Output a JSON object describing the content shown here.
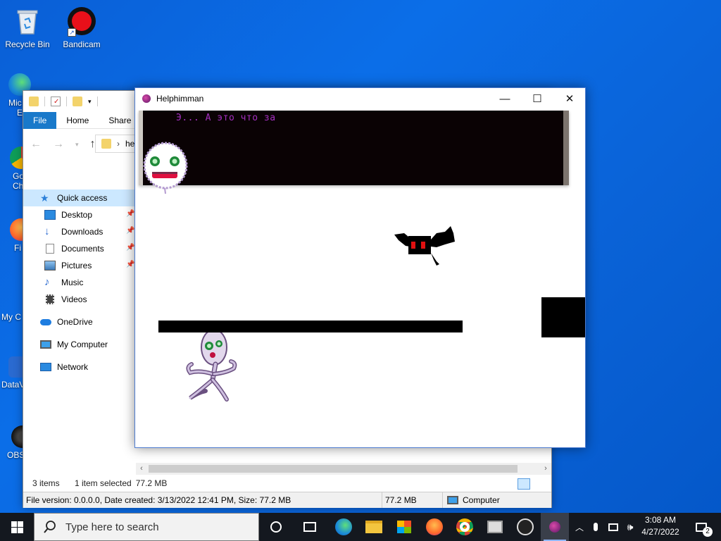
{
  "desktop": {
    "icons": [
      {
        "label": "Recycle Bin",
        "icon": "recycle-bin-icon"
      },
      {
        "label": "Bandicam",
        "icon": "bandicam-icon"
      }
    ],
    "partial_icons": [
      {
        "label": "Mic",
        "label2": "E",
        "icon": "edge-icon"
      },
      {
        "label": "Go",
        "label2": "Ch",
        "icon": "chrome-icon"
      },
      {
        "label": "Fi",
        "icon": "firefox-icon"
      },
      {
        "label": "My C",
        "icon": "computer-icon"
      },
      {
        "label": "DataV",
        "icon": "datav-icon"
      },
      {
        "label": "OBS",
        "icon": "obs-icon"
      }
    ]
  },
  "explorer": {
    "tabs": [
      "File",
      "Home",
      "Share"
    ],
    "address_fragment": "he",
    "nav": {
      "quick_access": "Quick access",
      "items": [
        {
          "label": "Desktop",
          "pinned": true
        },
        {
          "label": "Downloads",
          "pinned": true
        },
        {
          "label": "Documents",
          "pinned": true
        },
        {
          "label": "Pictures",
          "pinned": true
        },
        {
          "label": "Music",
          "pinned": false
        },
        {
          "label": "Videos",
          "pinned": false
        }
      ],
      "onedrive": "OneDrive",
      "my_computer": "My Computer",
      "network": "Network"
    },
    "status": {
      "items": "3 items",
      "selected": "1 item selected",
      "size": "77.2 MB"
    },
    "details": {
      "info": "File version: 0.0.0.0, Date created: 3/13/2022 12:41 PM, Size: 77.2 MB",
      "size": "77.2 MB",
      "location": "Computer"
    }
  },
  "game": {
    "title": "Helphimman",
    "dialog_text": "Э... А это что за",
    "colors": {
      "dialog_text": "#a52fc0",
      "dialog_bg": "#0a0204",
      "enemy_eyes": "#e01010",
      "player_body": "#b9a8cc"
    }
  },
  "taskbar": {
    "search_placeholder": "Type here to search",
    "time": "3:08 AM",
    "date": "4/27/2022",
    "notification_count": "2"
  }
}
